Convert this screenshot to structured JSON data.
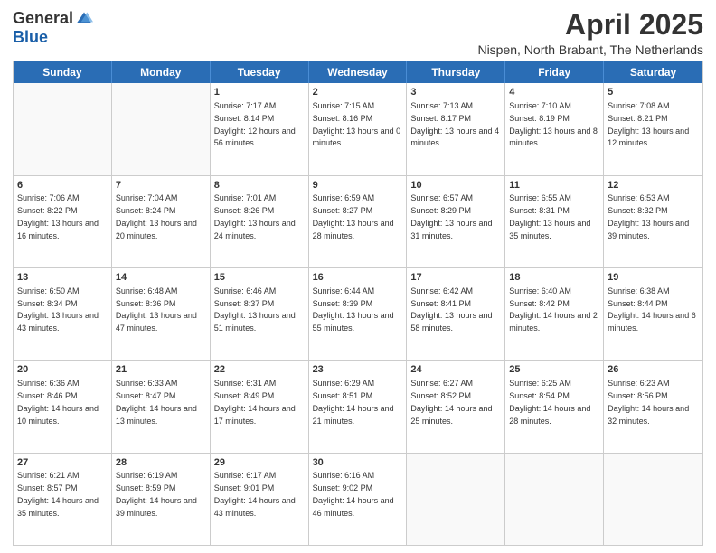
{
  "logo": {
    "general": "General",
    "blue": "Blue"
  },
  "title": "April 2025",
  "location": "Nispen, North Brabant, The Netherlands",
  "weekdays": [
    "Sunday",
    "Monday",
    "Tuesday",
    "Wednesday",
    "Thursday",
    "Friday",
    "Saturday"
  ],
  "weeks": [
    [
      {
        "day": "",
        "sunrise": "",
        "sunset": "",
        "daylight": ""
      },
      {
        "day": "",
        "sunrise": "",
        "sunset": "",
        "daylight": ""
      },
      {
        "day": "1",
        "sunrise": "Sunrise: 7:17 AM",
        "sunset": "Sunset: 8:14 PM",
        "daylight": "Daylight: 12 hours and 56 minutes."
      },
      {
        "day": "2",
        "sunrise": "Sunrise: 7:15 AM",
        "sunset": "Sunset: 8:16 PM",
        "daylight": "Daylight: 13 hours and 0 minutes."
      },
      {
        "day": "3",
        "sunrise": "Sunrise: 7:13 AM",
        "sunset": "Sunset: 8:17 PM",
        "daylight": "Daylight: 13 hours and 4 minutes."
      },
      {
        "day": "4",
        "sunrise": "Sunrise: 7:10 AM",
        "sunset": "Sunset: 8:19 PM",
        "daylight": "Daylight: 13 hours and 8 minutes."
      },
      {
        "day": "5",
        "sunrise": "Sunrise: 7:08 AM",
        "sunset": "Sunset: 8:21 PM",
        "daylight": "Daylight: 13 hours and 12 minutes."
      }
    ],
    [
      {
        "day": "6",
        "sunrise": "Sunrise: 7:06 AM",
        "sunset": "Sunset: 8:22 PM",
        "daylight": "Daylight: 13 hours and 16 minutes."
      },
      {
        "day": "7",
        "sunrise": "Sunrise: 7:04 AM",
        "sunset": "Sunset: 8:24 PM",
        "daylight": "Daylight: 13 hours and 20 minutes."
      },
      {
        "day": "8",
        "sunrise": "Sunrise: 7:01 AM",
        "sunset": "Sunset: 8:26 PM",
        "daylight": "Daylight: 13 hours and 24 minutes."
      },
      {
        "day": "9",
        "sunrise": "Sunrise: 6:59 AM",
        "sunset": "Sunset: 8:27 PM",
        "daylight": "Daylight: 13 hours and 28 minutes."
      },
      {
        "day": "10",
        "sunrise": "Sunrise: 6:57 AM",
        "sunset": "Sunset: 8:29 PM",
        "daylight": "Daylight: 13 hours and 31 minutes."
      },
      {
        "day": "11",
        "sunrise": "Sunrise: 6:55 AM",
        "sunset": "Sunset: 8:31 PM",
        "daylight": "Daylight: 13 hours and 35 minutes."
      },
      {
        "day": "12",
        "sunrise": "Sunrise: 6:53 AM",
        "sunset": "Sunset: 8:32 PM",
        "daylight": "Daylight: 13 hours and 39 minutes."
      }
    ],
    [
      {
        "day": "13",
        "sunrise": "Sunrise: 6:50 AM",
        "sunset": "Sunset: 8:34 PM",
        "daylight": "Daylight: 13 hours and 43 minutes."
      },
      {
        "day": "14",
        "sunrise": "Sunrise: 6:48 AM",
        "sunset": "Sunset: 8:36 PM",
        "daylight": "Daylight: 13 hours and 47 minutes."
      },
      {
        "day": "15",
        "sunrise": "Sunrise: 6:46 AM",
        "sunset": "Sunset: 8:37 PM",
        "daylight": "Daylight: 13 hours and 51 minutes."
      },
      {
        "day": "16",
        "sunrise": "Sunrise: 6:44 AM",
        "sunset": "Sunset: 8:39 PM",
        "daylight": "Daylight: 13 hours and 55 minutes."
      },
      {
        "day": "17",
        "sunrise": "Sunrise: 6:42 AM",
        "sunset": "Sunset: 8:41 PM",
        "daylight": "Daylight: 13 hours and 58 minutes."
      },
      {
        "day": "18",
        "sunrise": "Sunrise: 6:40 AM",
        "sunset": "Sunset: 8:42 PM",
        "daylight": "Daylight: 14 hours and 2 minutes."
      },
      {
        "day": "19",
        "sunrise": "Sunrise: 6:38 AM",
        "sunset": "Sunset: 8:44 PM",
        "daylight": "Daylight: 14 hours and 6 minutes."
      }
    ],
    [
      {
        "day": "20",
        "sunrise": "Sunrise: 6:36 AM",
        "sunset": "Sunset: 8:46 PM",
        "daylight": "Daylight: 14 hours and 10 minutes."
      },
      {
        "day": "21",
        "sunrise": "Sunrise: 6:33 AM",
        "sunset": "Sunset: 8:47 PM",
        "daylight": "Daylight: 14 hours and 13 minutes."
      },
      {
        "day": "22",
        "sunrise": "Sunrise: 6:31 AM",
        "sunset": "Sunset: 8:49 PM",
        "daylight": "Daylight: 14 hours and 17 minutes."
      },
      {
        "day": "23",
        "sunrise": "Sunrise: 6:29 AM",
        "sunset": "Sunset: 8:51 PM",
        "daylight": "Daylight: 14 hours and 21 minutes."
      },
      {
        "day": "24",
        "sunrise": "Sunrise: 6:27 AM",
        "sunset": "Sunset: 8:52 PM",
        "daylight": "Daylight: 14 hours and 25 minutes."
      },
      {
        "day": "25",
        "sunrise": "Sunrise: 6:25 AM",
        "sunset": "Sunset: 8:54 PM",
        "daylight": "Daylight: 14 hours and 28 minutes."
      },
      {
        "day": "26",
        "sunrise": "Sunrise: 6:23 AM",
        "sunset": "Sunset: 8:56 PM",
        "daylight": "Daylight: 14 hours and 32 minutes."
      }
    ],
    [
      {
        "day": "27",
        "sunrise": "Sunrise: 6:21 AM",
        "sunset": "Sunset: 8:57 PM",
        "daylight": "Daylight: 14 hours and 35 minutes."
      },
      {
        "day": "28",
        "sunrise": "Sunrise: 6:19 AM",
        "sunset": "Sunset: 8:59 PM",
        "daylight": "Daylight: 14 hours and 39 minutes."
      },
      {
        "day": "29",
        "sunrise": "Sunrise: 6:17 AM",
        "sunset": "Sunset: 9:01 PM",
        "daylight": "Daylight: 14 hours and 43 minutes."
      },
      {
        "day": "30",
        "sunrise": "Sunrise: 6:16 AM",
        "sunset": "Sunset: 9:02 PM",
        "daylight": "Daylight: 14 hours and 46 minutes."
      },
      {
        "day": "",
        "sunrise": "",
        "sunset": "",
        "daylight": ""
      },
      {
        "day": "",
        "sunrise": "",
        "sunset": "",
        "daylight": ""
      },
      {
        "day": "",
        "sunrise": "",
        "sunset": "",
        "daylight": ""
      }
    ]
  ]
}
